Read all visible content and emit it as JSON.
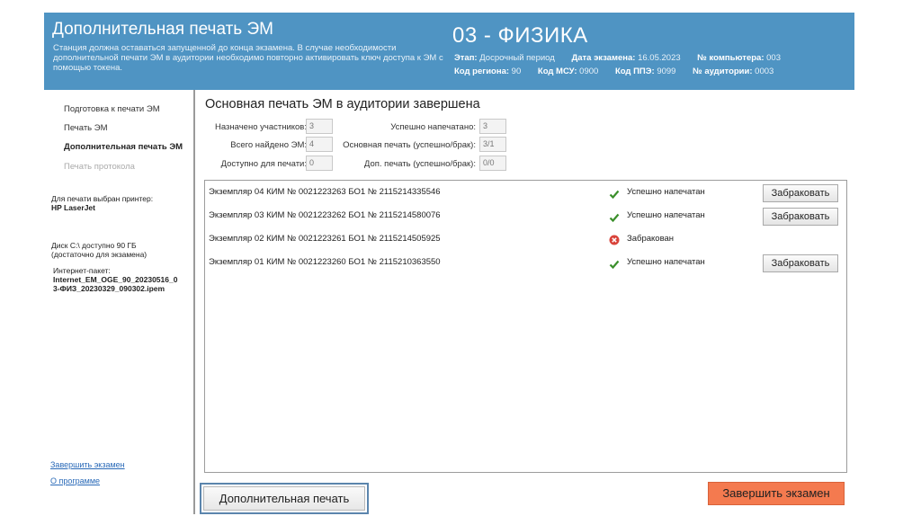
{
  "header": {
    "title": "Дополнительная печать ЭМ",
    "note": "Станция должна оставаться запущенной до конца экзамена. В случае необходимости дополнительной печати ЭМ в аудитории необходимо повторно активировать ключ доступа к ЭМ с помощью токена.",
    "subject": "03 - ФИЗИКА",
    "stage_label": "Этап:",
    "stage_value": "Досрочный период",
    "exam_date_label": "Дата экзамена:",
    "exam_date_value": "16.05.2023",
    "computer_label": "№ компьютера:",
    "computer_value": "003",
    "region_label": "Код региона:",
    "region_value": "90",
    "msu_label": "Код МСУ:",
    "msu_value": "0900",
    "ppe_label": "Код ППЭ:",
    "ppe_value": "9099",
    "auditorium_label": "№ аудитории:",
    "auditorium_value": "0003"
  },
  "sidebar": {
    "items": [
      {
        "label": "Подготовка к печати ЭМ",
        "state": "normal"
      },
      {
        "label": "Печать ЭМ",
        "state": "normal"
      },
      {
        "label": "Дополнительная печать ЭМ",
        "state": "active"
      },
      {
        "label": "Печать протокола",
        "state": "disabled"
      }
    ],
    "printer_label": "Для печати выбран принтер:",
    "printer_name": "HP LaserJet",
    "disk_line1": "Диск C:\\ доступно 90 ГБ",
    "disk_line2": "(достаточно для экзамена)",
    "package_label": "Интернет-пакет:",
    "package_line1": "Internet_EM_OGE_90_20230516_0",
    "package_line2": "3-ФИЗ_20230329_090302.ipem",
    "finish_link": "Завершить экзамен",
    "about_link": "О программе"
  },
  "main": {
    "title": "Основная печать ЭМ в аудитории завершена",
    "stats": {
      "assigned_label": "Назначено участников:",
      "assigned_value": "3",
      "found_label": "Всего найдено ЭМ:",
      "found_value": "4",
      "available_label": "Доступно для печати:",
      "available_value": "0",
      "printed_label": "Успешно напечатано:",
      "printed_value": "3",
      "main_print_label": "Основная печать (успешно/брак):",
      "main_print_value": "3/1",
      "extra_print_label": "Доп. печать (успешно/брак):",
      "extra_print_value": "0/0"
    },
    "rows": [
      {
        "text": "Экземпляр 04  КИМ № 0021223263  БО1 № 2115214335546",
        "status": "Успешно напечатан",
        "icon": "check-icon",
        "button": "Забраковать"
      },
      {
        "text": "Экземпляр 03  КИМ № 0021223262  БО1 № 2115214580076",
        "status": "Успешно напечатан",
        "icon": "check-icon",
        "button": "Забраковать"
      },
      {
        "text": "Экземпляр 02  КИМ № 0021223261  БО1 № 2115214505925",
        "status": "Забракован",
        "icon": "reject-icon",
        "button": ""
      },
      {
        "text": "Экземпляр 01  КИМ № 0021223260  БО1 № 2115210363550",
        "status": "Успешно напечатан",
        "icon": "check-icon",
        "button": "Забраковать"
      }
    ],
    "extra_print_button": "Дополнительная печать",
    "finish_button": "Завершить экзамен"
  },
  "colors": {
    "header_bg": "#4f94c3",
    "finish_button": "#f47a4f",
    "check": "#3a8f2a",
    "reject": "#d9433a"
  }
}
